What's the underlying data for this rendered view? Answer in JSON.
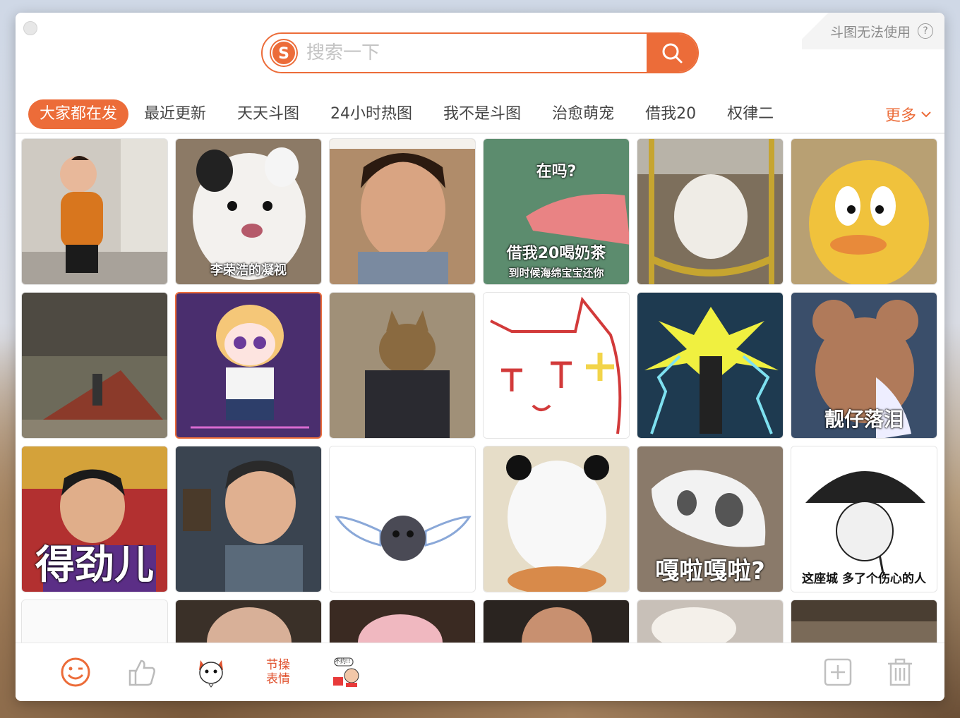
{
  "corner_help": {
    "label": "斗图无法使用",
    "icon": "question-circle-icon"
  },
  "search": {
    "placeholder": "搜索一下",
    "logo_icon": "sogou-logo-icon",
    "button_icon": "search-icon"
  },
  "tabs": [
    {
      "label": "大家都在发",
      "active": true
    },
    {
      "label": "最近更新"
    },
    {
      "label": "天天斗图"
    },
    {
      "label": "24小时热图"
    },
    {
      "label": "我不是斗图"
    },
    {
      "label": "治愈萌宠"
    },
    {
      "label": "借我20"
    },
    {
      "label": "权律二"
    }
  ],
  "more": {
    "label": "更多",
    "icon": "chevron-down-icon"
  },
  "accent": "#ec6c39",
  "grid": [
    {
      "name": "sticker-running-kid",
      "caption": ""
    },
    {
      "name": "sticker-puppy-stare",
      "caption": "李荣浩的凝视"
    },
    {
      "name": "sticker-man-looking-down",
      "caption": ""
    },
    {
      "name": "sticker-patrick-hand",
      "caption": "借我20喝奶茶",
      "subcaption": "到时候海绵宝宝还你",
      "topcaption": "在吗?"
    },
    {
      "name": "sticker-dog-swing",
      "caption": ""
    },
    {
      "name": "sticker-yellow-duck",
      "caption": ""
    },
    {
      "name": "sticker-man-bricks",
      "caption": ""
    },
    {
      "name": "sticker-anime-girl-dance",
      "caption": ""
    },
    {
      "name": "sticker-cat-suit",
      "caption": ""
    },
    {
      "name": "sticker-cat-face-drawing",
      "caption": ""
    },
    {
      "name": "sticker-lightning-man",
      "caption": ""
    },
    {
      "name": "sticker-jerry-crying",
      "caption": "靓仔落泪"
    },
    {
      "name": "sticker-man-microphone",
      "caption": "得劲儿"
    },
    {
      "name": "sticker-man-gun",
      "caption": ""
    },
    {
      "name": "sticker-winged-moon",
      "caption": ""
    },
    {
      "name": "sticker-panda-noodles",
      "caption": ""
    },
    {
      "name": "sticker-cat-skull-mask",
      "caption": "嘎啦嘎啦?"
    },
    {
      "name": "sticker-panda-umbrella",
      "caption": "这座城 多了个伤心的人"
    },
    {
      "name": "sticker-partial-1",
      "caption": ""
    },
    {
      "name": "sticker-partial-2",
      "caption": ""
    },
    {
      "name": "sticker-partial-3",
      "caption": ""
    },
    {
      "name": "sticker-partial-4",
      "caption": ""
    },
    {
      "name": "sticker-partial-5",
      "caption": ""
    },
    {
      "name": "sticker-partial-6",
      "caption": ""
    }
  ],
  "toolbar": {
    "items": [
      {
        "name": "emoji-face-icon"
      },
      {
        "name": "thumbs-up-icon"
      },
      {
        "name": "mascot-dog-icon"
      },
      {
        "name": "jiecao-sticker-pack",
        "line1": "节操",
        "line2": "表情"
      },
      {
        "name": "buyue-sticker-pack",
        "label": "不约!!"
      }
    ],
    "add_icon": "add-square-icon",
    "trash_icon": "trash-icon"
  }
}
